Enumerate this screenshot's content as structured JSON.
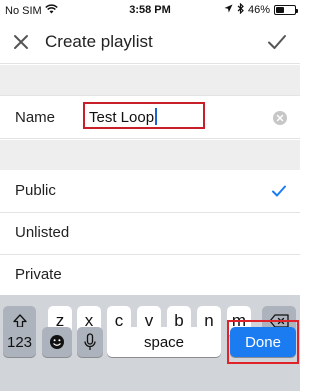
{
  "status_bar": {
    "carrier": "No SIM",
    "time": "3:58 PM",
    "battery": "46%",
    "battery_level": 0.46
  },
  "app_bar": {
    "title": "Create playlist"
  },
  "form": {
    "name_label": "Name",
    "name_value": "Test Loop"
  },
  "privacy_options": [
    {
      "label": "Public",
      "selected": true
    },
    {
      "label": "Unlisted",
      "selected": false
    },
    {
      "label": "Private",
      "selected": false
    }
  ],
  "keyboard": {
    "letters": [
      "z",
      "x",
      "c",
      "v",
      "b",
      "n",
      "m"
    ],
    "numbers_key": "123",
    "space_key": "space",
    "done_key": "Done"
  },
  "colors": {
    "accent": "#1b7cf2",
    "highlight_outline": "#e0222a"
  }
}
